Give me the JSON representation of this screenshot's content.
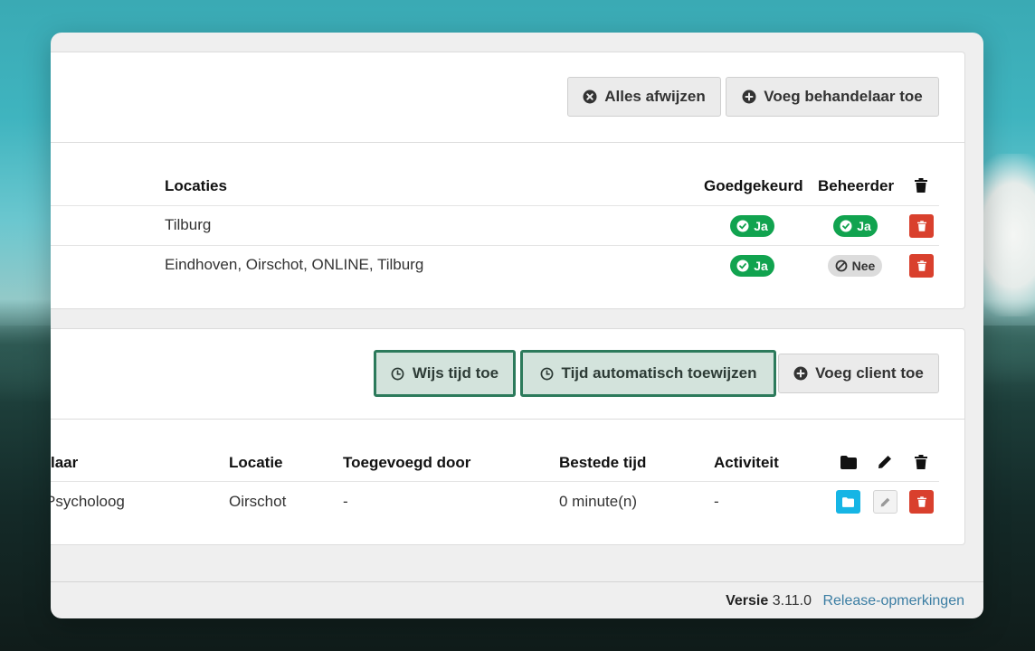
{
  "panel1": {
    "buttons": {
      "reject_all": "Alles afwijzen",
      "add_therapist": "Voeg behandelaar toe"
    },
    "table": {
      "headers": {
        "locations": "Locaties",
        "approved": "Goedgekeurd",
        "admin": "Beheerder"
      },
      "rows": [
        {
          "locations": "Tilburg",
          "approved": "Ja",
          "admin": "Ja"
        },
        {
          "locations": "Eindhoven, Oirschot, ONLINE, Tilburg",
          "approved": "Ja",
          "admin": "Nee"
        }
      ]
    }
  },
  "panel2": {
    "buttons": {
      "assign_time": "Wijs tijd toe",
      "auto_assign": "Tijd automatisch toewijzen",
      "add_client": "Voeg client toe"
    },
    "table": {
      "headers": {
        "therapist_partial": "laar",
        "location": "Locatie",
        "added_by": "Toegevoegd door",
        "time_spent": "Bestede tijd",
        "activity": "Activiteit"
      },
      "rows": [
        {
          "therapist_partial": "Psycholoog",
          "location": "Oirschot",
          "added_by": "-",
          "time_spent": "0 minute(n)",
          "activity": "-"
        }
      ]
    }
  },
  "footer": {
    "version_label": "Versie",
    "version": "3.11.0",
    "release_notes": "Release-opmerkingen"
  },
  "colors": {
    "success": "#11a34f",
    "danger": "#d9402d",
    "info": "#16b5e5",
    "highlight_border": "#2c7a5b",
    "link": "#3c7ea3"
  },
  "icons": [
    "times-circle-icon",
    "plus-circle-icon",
    "clock-icon",
    "check-circle-icon",
    "ban-icon",
    "trash-icon",
    "folder-icon",
    "pencil-icon"
  ]
}
